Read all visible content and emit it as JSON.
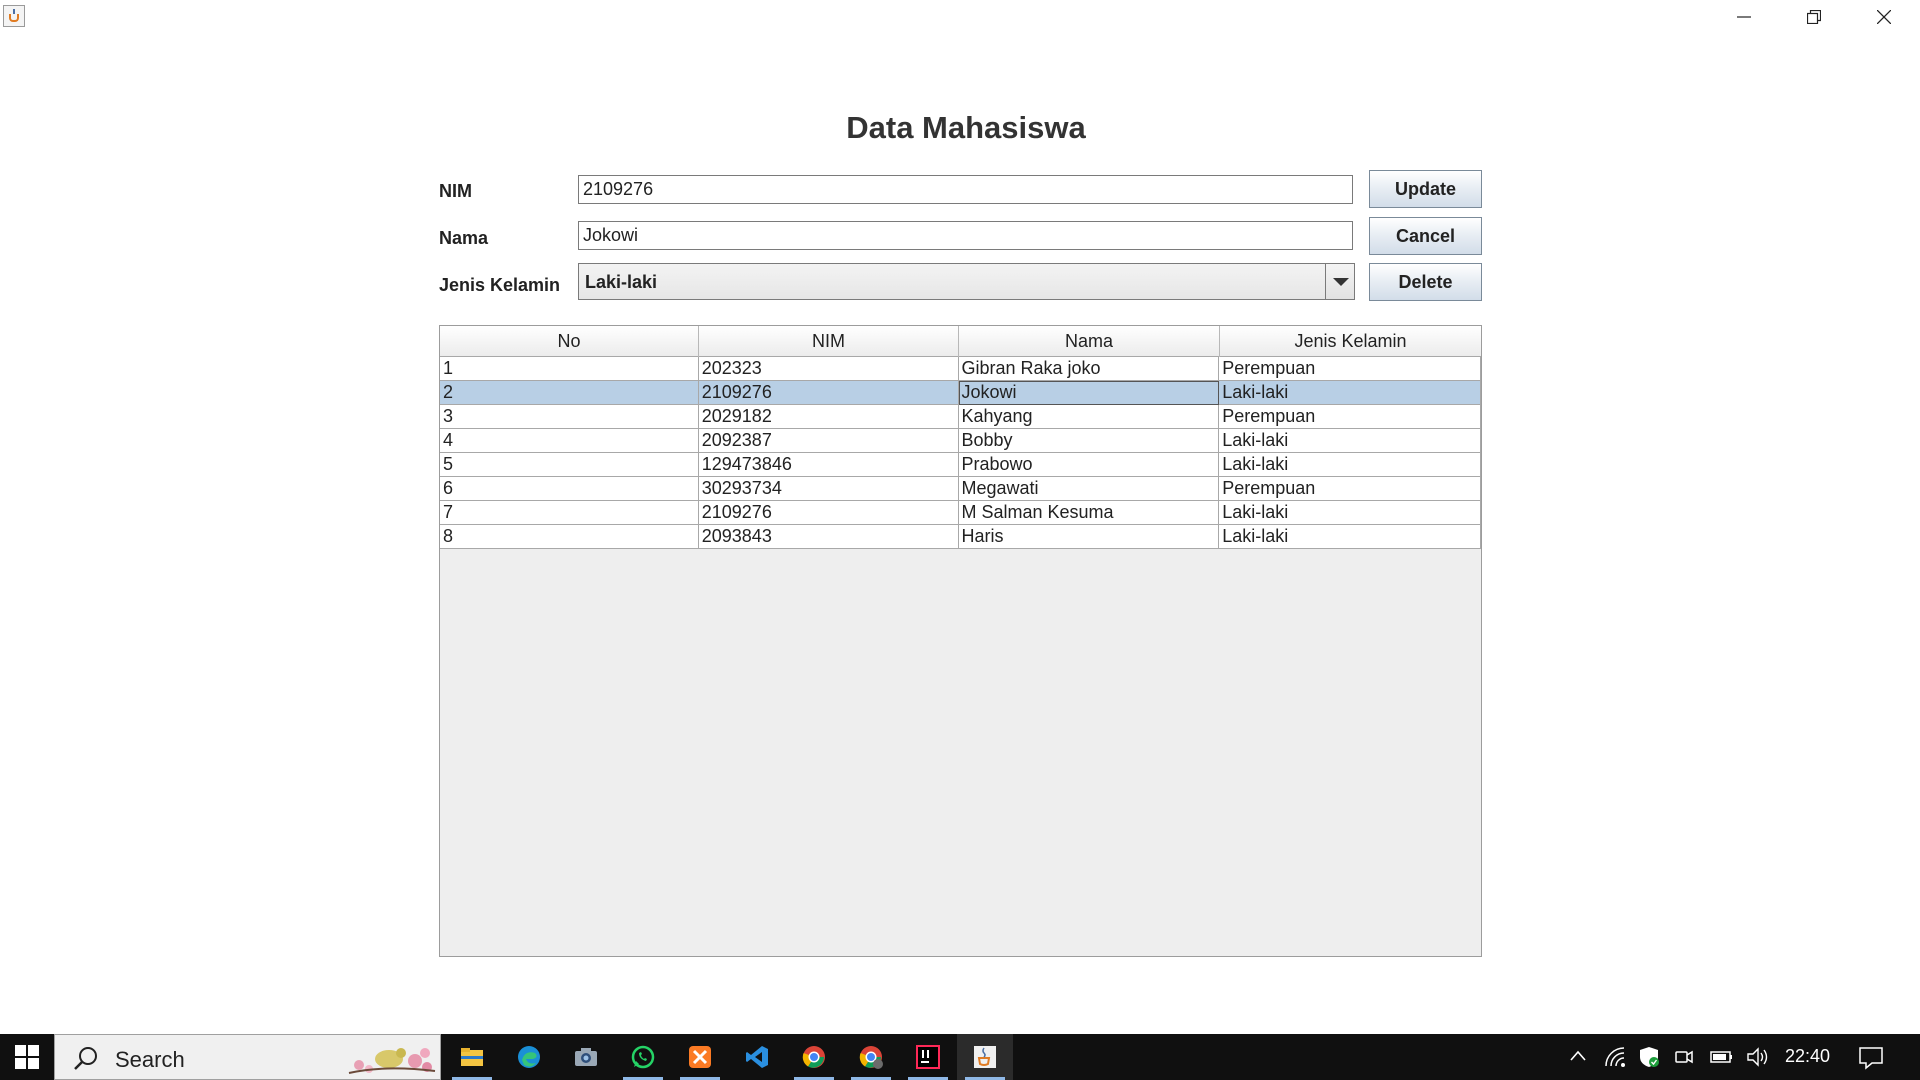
{
  "form": {
    "title": "Data Mahasiswa",
    "nim_label": "NIM",
    "nim_value": "2109276",
    "nama_label": "Nama",
    "nama_value": "Jokowi",
    "jk_label": "Jenis Kelamin",
    "jk_value": "Laki-laki"
  },
  "buttons": {
    "update": "Update",
    "cancel": "Cancel",
    "delete": "Delete"
  },
  "table": {
    "headers": [
      "No",
      "NIM",
      "Nama",
      "Jenis Kelamin"
    ],
    "selected_row": 1,
    "rows": [
      [
        "1",
        "202323",
        "Gibran Raka joko",
        "Perempuan"
      ],
      [
        "2",
        "2109276",
        "Jokowi",
        "Laki-laki"
      ],
      [
        "3",
        "2029182",
        "Kahyang",
        "Perempuan"
      ],
      [
        "4",
        "2092387",
        "Bobby",
        "Laki-laki"
      ],
      [
        "5",
        "129473846",
        "Prabowo",
        "Laki-laki"
      ],
      [
        "6",
        "30293734",
        "Megawati",
        "Perempuan"
      ],
      [
        "7",
        "2109276",
        "M Salman Kesuma",
        "Laki-laki"
      ],
      [
        "8",
        "2093843",
        "Haris",
        "Laki-laki"
      ]
    ]
  },
  "taskbar": {
    "search_text": "Search",
    "clock": "22:40",
    "apps": [
      "file-explorer-icon",
      "edge-icon",
      "camera-icon",
      "whatsapp-icon",
      "xampp-icon",
      "vscode-icon",
      "chrome-icon",
      "chrome-profile-icon",
      "intellij-icon",
      "java-icon"
    ]
  },
  "colors": {
    "selected_row": "#b8cfe5",
    "taskbar": "#101010",
    "title_text": "#333333"
  }
}
